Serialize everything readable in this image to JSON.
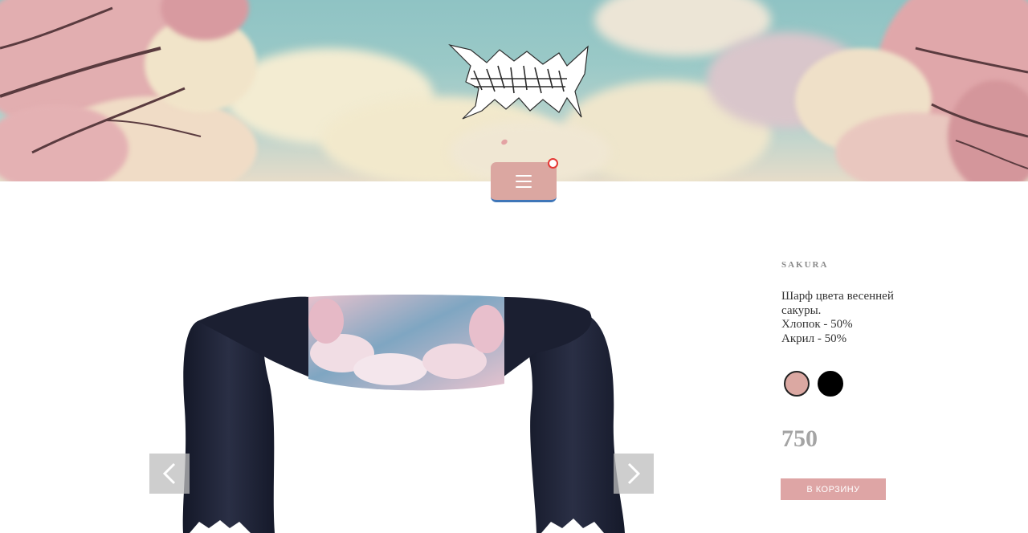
{
  "header": {
    "logo_alt": "ARMYVAL",
    "menu_label": "☰",
    "menu_badge_color": "#e53935"
  },
  "gallery": {
    "prev_icon": "chevron-left-icon",
    "next_icon": "chevron-right-icon"
  },
  "product": {
    "name": "SAKURA",
    "description_lines": [
      "Шарф цвета весенней",
      "сакуры.",
      "Хлопок - 50%",
      "Акрил - 50%"
    ],
    "colors": [
      "#dba8a2",
      "#000000"
    ],
    "price": "750",
    "cart_button": "В КОРЗИНУ"
  },
  "theme": {
    "accent": "#dba7a1",
    "menu_border": "#3f76b8"
  }
}
